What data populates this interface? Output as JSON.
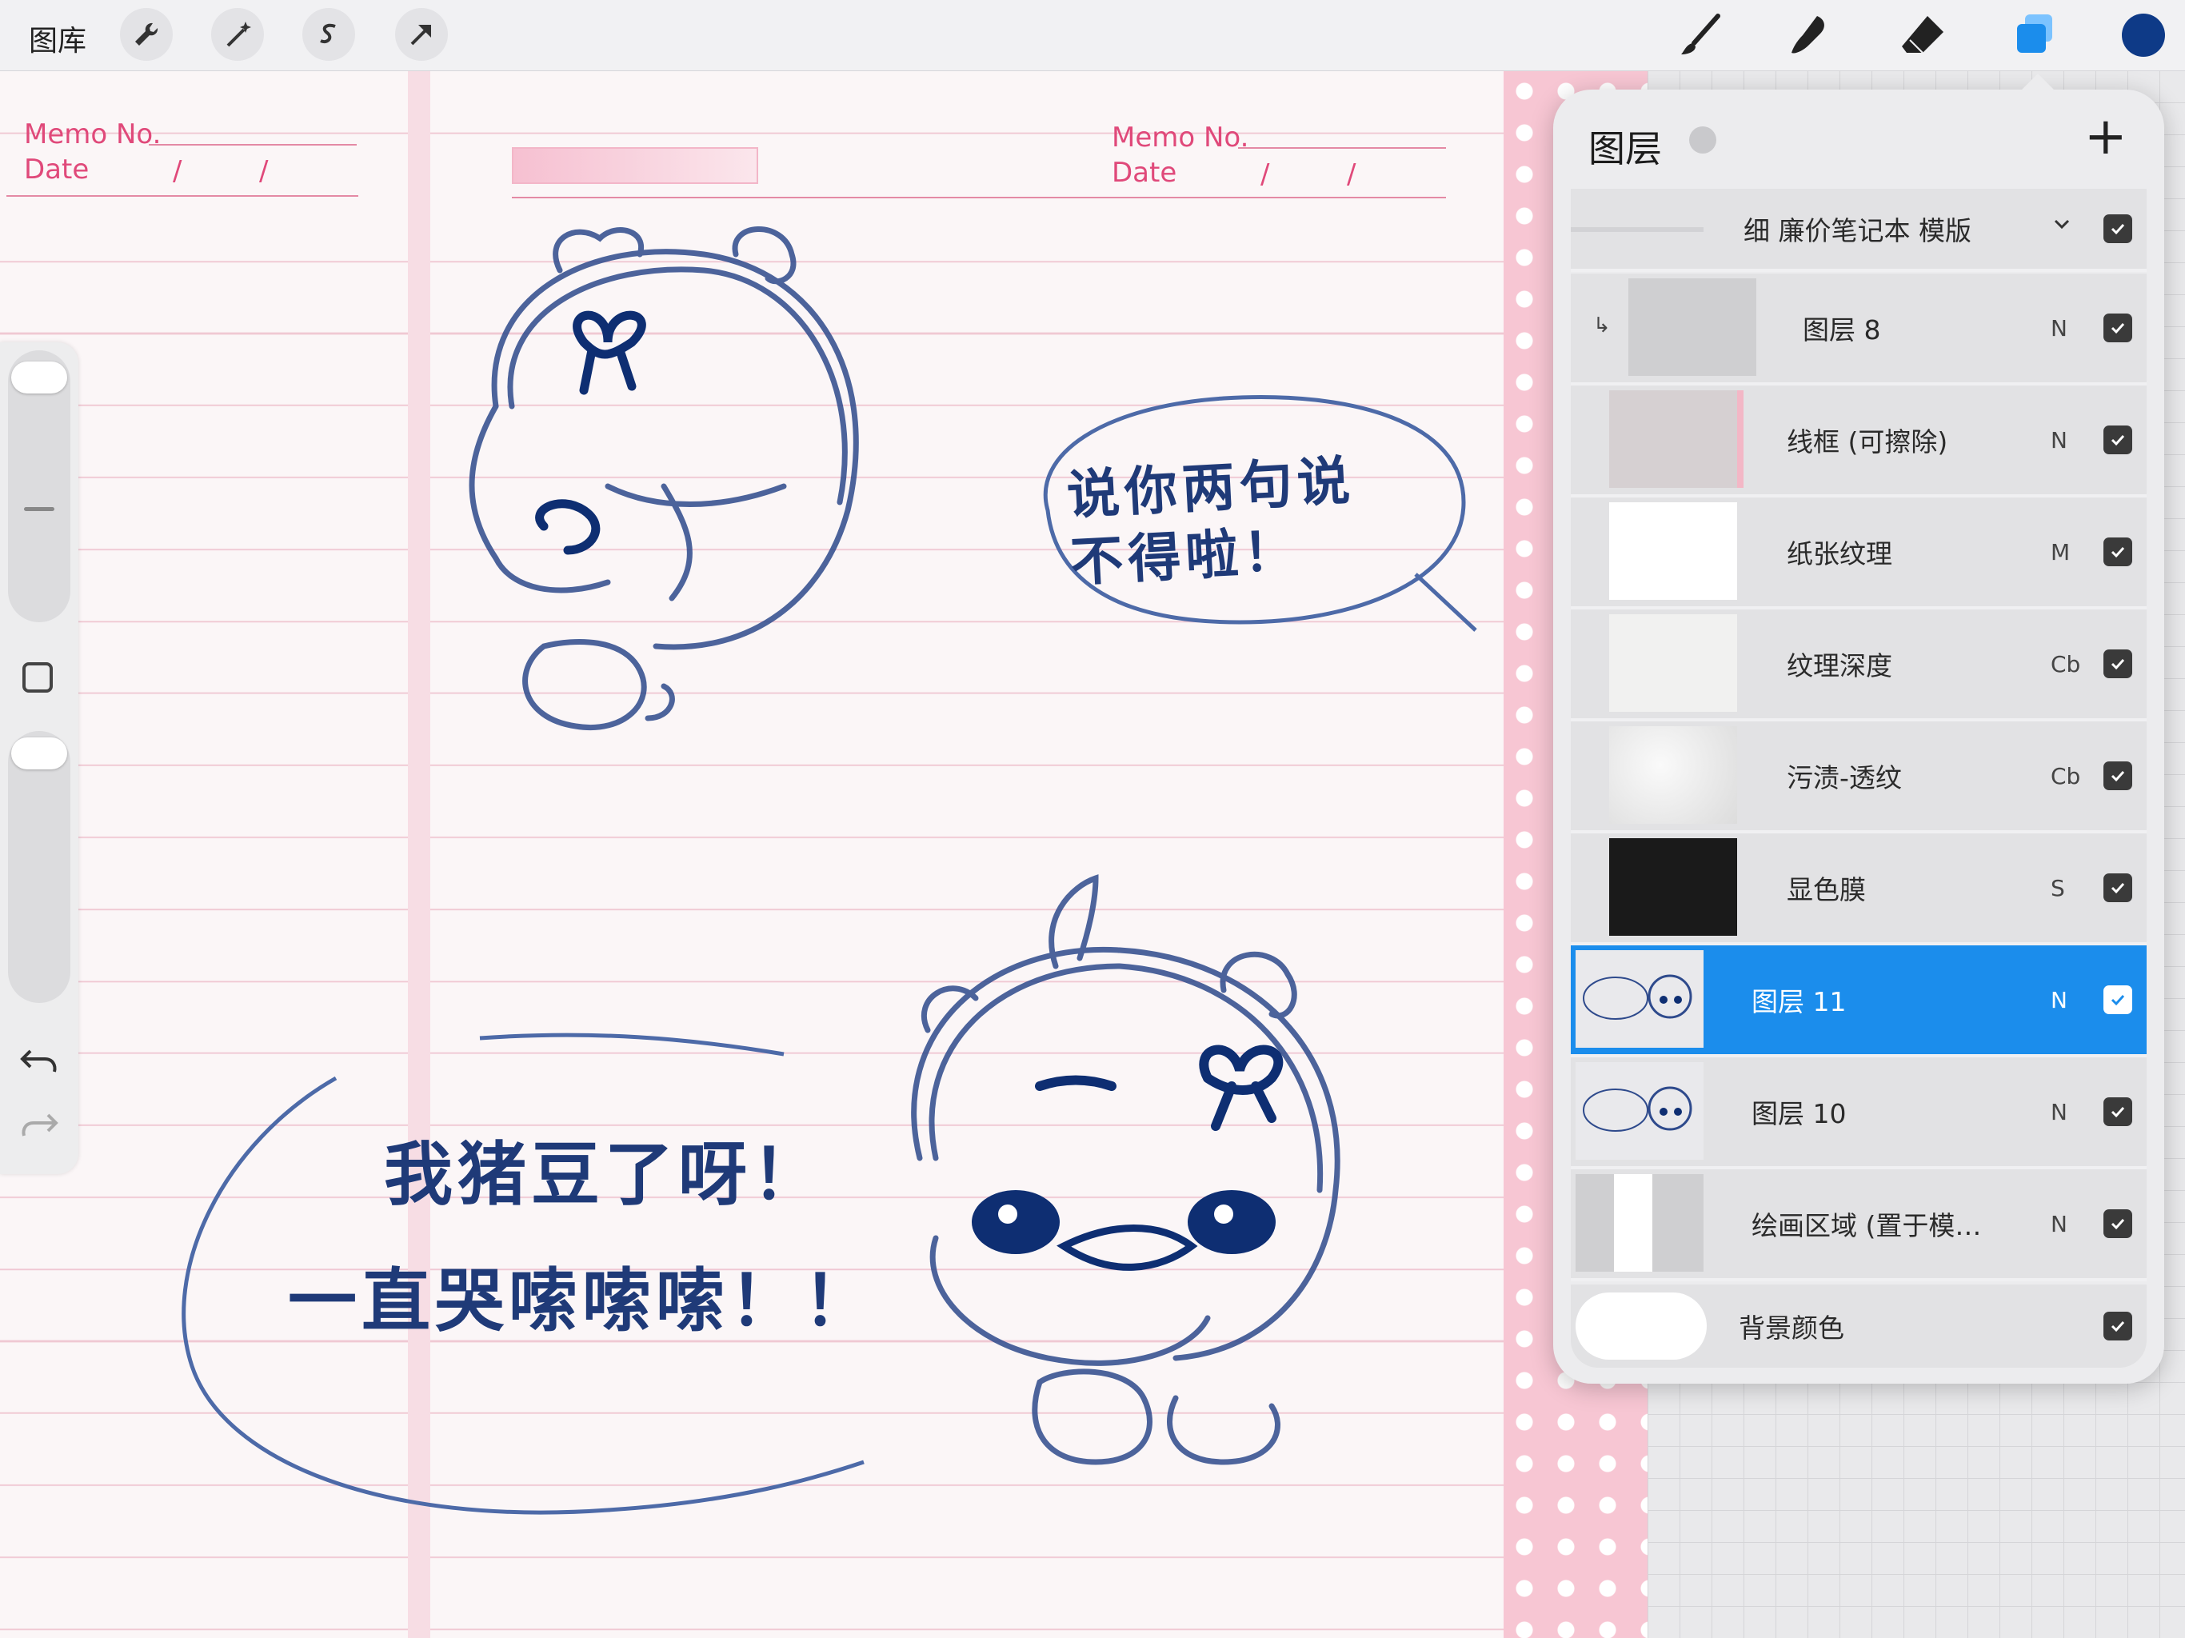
{
  "topbar": {
    "gallery_label": "图库",
    "tools_left": [
      "wrench-icon",
      "magic-wand-icon",
      "selection-s-icon",
      "transform-arrow-icon"
    ],
    "tools_right": [
      "brush-icon",
      "smudge-icon",
      "eraser-icon",
      "layers-icon",
      "color-swatch"
    ],
    "current_color": "#0e3a87",
    "layers_accent": "#1b8dec"
  },
  "canvas": {
    "memo_label_1": "Memo No.",
    "date_label_1": "Date",
    "date_slash": "/",
    "memo_label_2": "Memo No.",
    "date_label_2": "Date",
    "bubble_1": "说你两句说\n不得啦！",
    "bubble_2_line1": "我猪豆了呀！",
    "bubble_2_line2": "一直哭嗦嗦嗦！！",
    "ink_color": "#1f3a78",
    "memo_color": "#e0497a"
  },
  "layers_panel": {
    "title": "图层",
    "add_label": "+",
    "group": {
      "name": "细 廉价笔记本 模版"
    },
    "layers": [
      {
        "name": "图层 8",
        "blend": "N",
        "visible": true,
        "selected": false,
        "thumb": "light-grey"
      },
      {
        "name": "线框 (可擦除)",
        "blend": "N",
        "visible": true,
        "selected": false,
        "thumb": "pink-frame"
      },
      {
        "name": "纸张纹理",
        "blend": "M",
        "visible": true,
        "selected": false,
        "thumb": "white"
      },
      {
        "name": "纹理深度",
        "blend": "Cb",
        "visible": true,
        "selected": false,
        "thumb": "off-white"
      },
      {
        "name": "污渍-透纹",
        "blend": "Cb",
        "visible": true,
        "selected": false,
        "thumb": "stain"
      },
      {
        "name": "显色膜",
        "blend": "S",
        "visible": true,
        "selected": false,
        "thumb": "black"
      },
      {
        "name": "图层 11",
        "blend": "N",
        "visible": true,
        "selected": true,
        "thumb": "sketch"
      },
      {
        "name": "图层 10",
        "blend": "N",
        "visible": true,
        "selected": false,
        "thumb": "sketch"
      },
      {
        "name": "绘画区域 (置于模…",
        "blend": "N",
        "visible": true,
        "selected": false,
        "thumb": "white-strip"
      }
    ],
    "background": {
      "name": "背景颜色",
      "visible": true
    }
  }
}
